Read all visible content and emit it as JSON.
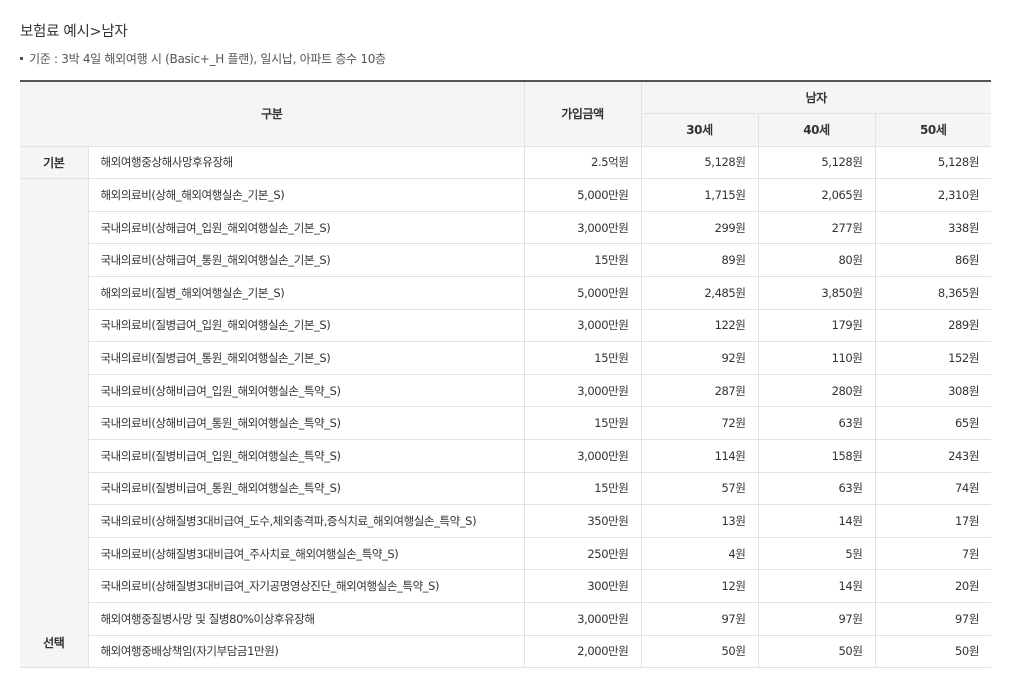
{
  "page": {
    "title": "보험료 예시>남자",
    "basis": "기준 : 3박 4일 해외여행 시 (Basic+_H 플랜), 일시납, 아파트 층수 10층"
  },
  "table": {
    "headers": {
      "category": "구분",
      "amount": "가입금액",
      "gender": "남자",
      "ages": [
        "30세",
        "40세",
        "50세"
      ]
    },
    "categories": {
      "basic": "기본",
      "optional": "선택"
    },
    "rows": [
      {
        "coverage": "해외여행중상해사망후유장해",
        "amount": "2.5억원",
        "p30": "5,128원",
        "p40": "5,128원",
        "p50": "5,128원"
      },
      {
        "coverage": "해외의료비(상해_해외여행실손_기본_S)",
        "amount": "5,000만원",
        "p30": "1,715원",
        "p40": "2,065원",
        "p50": "2,310원"
      },
      {
        "coverage": "국내의료비(상해급여_입원_해외여행실손_기본_S)",
        "amount": "3,000만원",
        "p30": "299원",
        "p40": "277원",
        "p50": "338원"
      },
      {
        "coverage": "국내의료비(상해급여_통원_해외여행실손_기본_S)",
        "amount": "15만원",
        "p30": "89원",
        "p40": "80원",
        "p50": "86원"
      },
      {
        "coverage": "해외의료비(질병_해외여행실손_기본_S)",
        "amount": "5,000만원",
        "p30": "2,485원",
        "p40": "3,850원",
        "p50": "8,365원"
      },
      {
        "coverage": "국내의료비(질병급여_입원_해외여행실손_기본_S)",
        "amount": "3,000만원",
        "p30": "122원",
        "p40": "179원",
        "p50": "289원"
      },
      {
        "coverage": "국내의료비(질병급여_통원_해외여행실손_기본_S)",
        "amount": "15만원",
        "p30": "92원",
        "p40": "110원",
        "p50": "152원"
      },
      {
        "coverage": "국내의료비(상해비급여_입원_해외여행실손_특약_S)",
        "amount": "3,000만원",
        "p30": "287원",
        "p40": "280원",
        "p50": "308원"
      },
      {
        "coverage": "국내의료비(상해비급여_통원_해외여행실손_특약_S)",
        "amount": "15만원",
        "p30": "72원",
        "p40": "63원",
        "p50": "65원"
      },
      {
        "coverage": "국내의료비(질병비급여_입원_해외여행실손_특약_S)",
        "amount": "3,000만원",
        "p30": "114원",
        "p40": "158원",
        "p50": "243원"
      },
      {
        "coverage": "국내의료비(질병비급여_통원_해외여행실손_특약_S)",
        "amount": "15만원",
        "p30": "57원",
        "p40": "63원",
        "p50": "74원"
      },
      {
        "coverage": "국내의료비(상해질병3대비급여_도수,체외충격파,증식치료_해외여행실손_특약_S)",
        "amount": "350만원",
        "p30": "13원",
        "p40": "14원",
        "p50": "17원"
      },
      {
        "coverage": "국내의료비(상해질병3대비급여_주사치료_해외여행실손_특약_S)",
        "amount": "250만원",
        "p30": "4원",
        "p40": "5원",
        "p50": "7원"
      },
      {
        "coverage": "국내의료비(상해질병3대비급여_자기공명영상진단_해외여행실손_특약_S)",
        "amount": "300만원",
        "p30": "12원",
        "p40": "14원",
        "p50": "20원"
      },
      {
        "coverage": "해외여행중질병사망 및 질병80%이상후유장해",
        "amount": "3,000만원",
        "p30": "97원",
        "p40": "97원",
        "p50": "97원"
      },
      {
        "coverage": "해외여행중배상책임(자기부담금1만원)",
        "amount": "2,000만원",
        "p30": "50원",
        "p40": "50원",
        "p50": "50원"
      }
    ]
  }
}
